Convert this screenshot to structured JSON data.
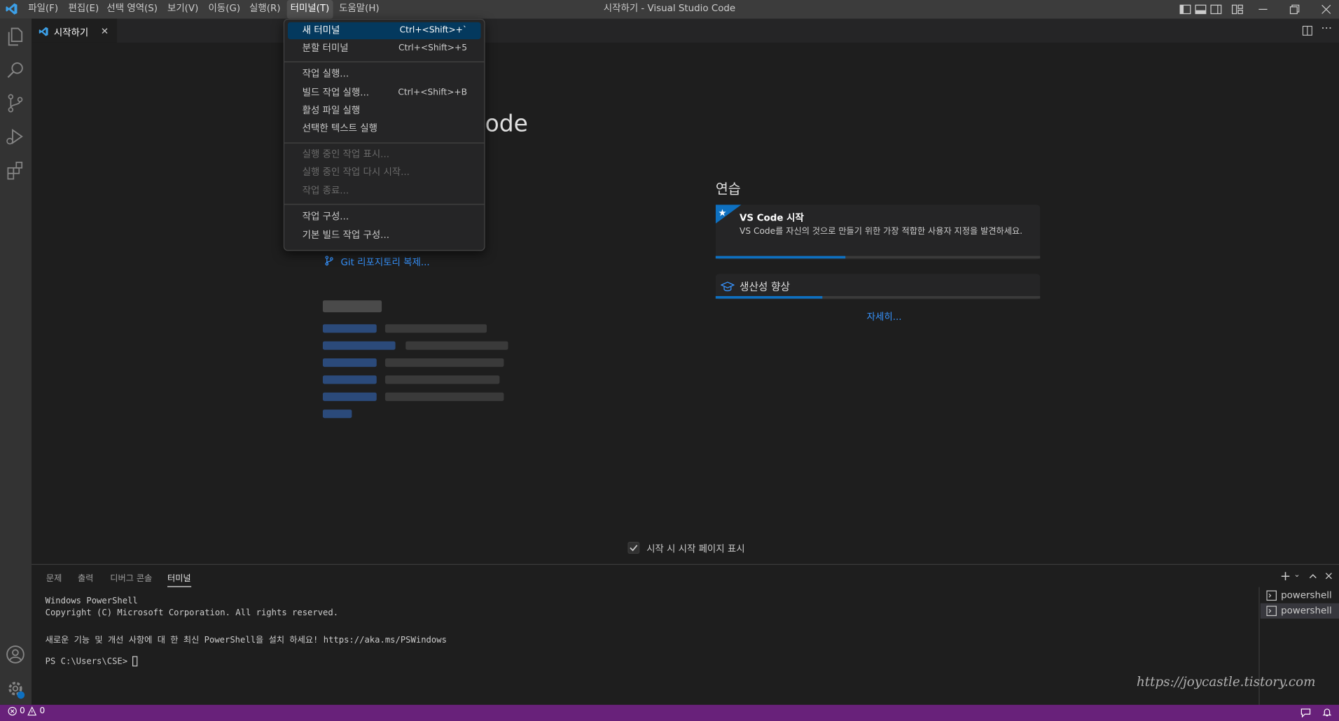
{
  "window": {
    "title": "시작하기 - Visual Studio Code"
  },
  "menubar": [
    {
      "label": "파일(F)"
    },
    {
      "label": "편집(E)"
    },
    {
      "label": "선택 영역(S)"
    },
    {
      "label": "보기(V)"
    },
    {
      "label": "이동(G)"
    },
    {
      "label": "실행(R)"
    },
    {
      "label": "터미널(T)"
    },
    {
      "label": "도움말(H)"
    }
  ],
  "terminal_menu": {
    "items": [
      {
        "label": "새 터미널",
        "shortcut": "Ctrl+<Shift>+`"
      },
      {
        "label": "분할 터미널",
        "shortcut": "Ctrl+<Shift>+5"
      },
      {
        "label": "작업 실행...",
        "shortcut": ""
      },
      {
        "label": "빌드 작업 실행...",
        "shortcut": "Ctrl+<Shift>+B"
      },
      {
        "label": "활성 파일 실행",
        "shortcut": ""
      },
      {
        "label": "선택한 텍스트 실행",
        "shortcut": ""
      },
      {
        "label": "실행 중인 작업 표시...",
        "shortcut": ""
      },
      {
        "label": "실행 중인 작업 다시 시작...",
        "shortcut": ""
      },
      {
        "label": "작업 종료...",
        "shortcut": ""
      },
      {
        "label": "작업 구성...",
        "shortcut": ""
      },
      {
        "label": "기본 빌드 작업 구성...",
        "shortcut": ""
      }
    ]
  },
  "tab": {
    "label": "시작하기",
    "close": "✕"
  },
  "welcome": {
    "title_fragment": "ode",
    "clone_link": "Git 리포지토리 복제...",
    "walkthroughs_heading": "연습",
    "card1": {
      "title": "VS Code 시작",
      "description": "VS Code를 자신의 것으로 만들기 위한 가장 적합한 사용자 지정을 발견하세요.",
      "progress": 0.4
    },
    "card2": {
      "title": "생산성 향상",
      "progress": 0.33
    },
    "more_link": "자세히...",
    "show_on_startup": "시작 시 시작 페이지 표시"
  },
  "panel": {
    "tabs": [
      "문제",
      "출력",
      "디버그 콘솔",
      "터미널"
    ],
    "active_tab": "터미널",
    "terminal_lines": [
      "Windows PowerShell",
      "Copyright (C) Microsoft Corporation. All rights reserved.",
      "새로운 기능 및 개선 사항에 대 한 최신 PowerShell을 설치 하세요! https://aka.ms/PSWindows",
      "PS C:\\Users\\CSE> "
    ],
    "terminals": [
      "powershell",
      "powershell"
    ]
  },
  "statusbar": {
    "errors": "0",
    "warnings": "0"
  },
  "watermark": "https://joycastle.tistory.com",
  "colors": {
    "statusbar": "#68217a",
    "accent": "#0e70c0",
    "link": "#3794ff"
  }
}
